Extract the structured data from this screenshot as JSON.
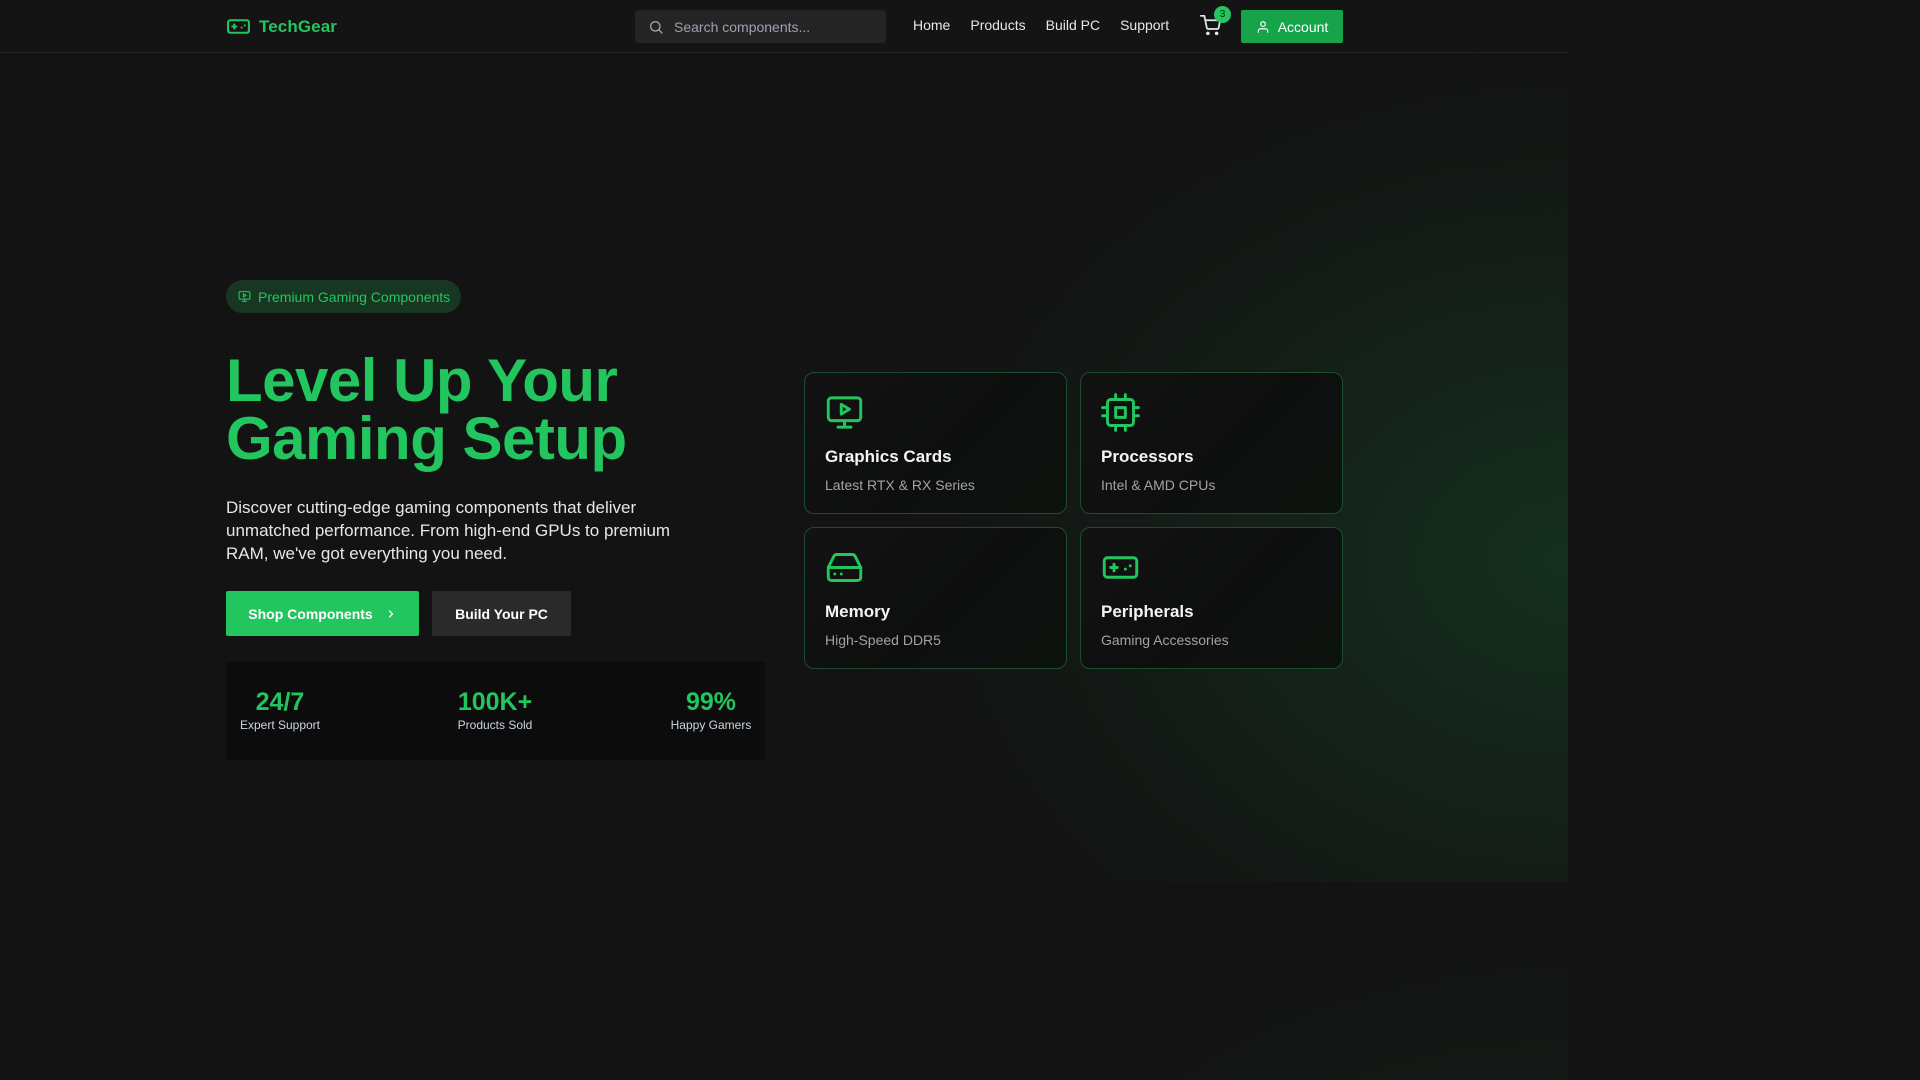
{
  "brand": {
    "name": "TechGear",
    "accent": "#22c55e",
    "logo_icon": "gamepad-icon"
  },
  "search": {
    "placeholder": "Search components..."
  },
  "nav": {
    "items": [
      "Home",
      "Products",
      "Build PC",
      "Support"
    ]
  },
  "cart": {
    "count": "3",
    "icon": "cart-icon"
  },
  "account": {
    "label": "Account",
    "icon": "user-icon"
  },
  "hero": {
    "badge": "Premium Gaming Components",
    "badge_icon": "monitor-icon",
    "title": "Level Up Your Gaming Setup",
    "description": "Discover cutting-edge gaming components that deliver unmatched performance. From high-end GPUs to premium RAM, we've got everything you need.",
    "primary_cta": "Shop Components",
    "secondary_cta": "Build Your PC"
  },
  "stats": [
    {
      "value": "24/7",
      "label": "Expert Support"
    },
    {
      "value": "100K+",
      "label": "Products Sold"
    },
    {
      "value": "99%",
      "label": "Happy Gamers"
    }
  ],
  "categories": [
    {
      "title": "Graphics Cards",
      "subtitle": "Latest RTX & RX Series",
      "icon": "monitor-play-icon"
    },
    {
      "title": "Processors",
      "subtitle": "Intel & AMD CPUs",
      "icon": "cpu-icon"
    },
    {
      "title": "Memory",
      "subtitle": "High-Speed DDR5",
      "icon": "hard-drive-icon"
    },
    {
      "title": "Peripherals",
      "subtitle": "Gaming Accessories",
      "icon": "gamepad-icon"
    }
  ]
}
